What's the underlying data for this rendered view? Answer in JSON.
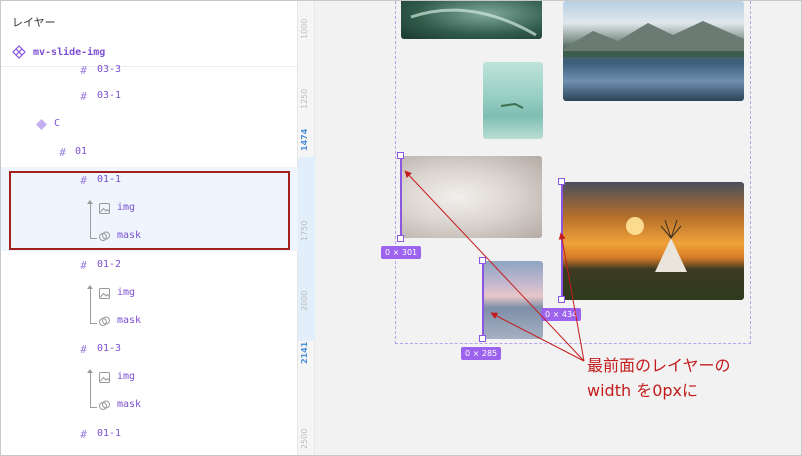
{
  "layers_panel": {
    "title": "レイヤー",
    "component_name": "mv-slide-img",
    "rows": [
      {
        "kind": "frame",
        "label": "03-3"
      },
      {
        "kind": "frame",
        "label": "03-1"
      },
      {
        "kind": "variant",
        "label": "C"
      },
      {
        "kind": "frame",
        "label": "01"
      },
      {
        "kind": "frame",
        "label": "01-1"
      },
      {
        "kind": "image",
        "label": "img"
      },
      {
        "kind": "mask",
        "label": "mask"
      },
      {
        "kind": "frame",
        "label": "01-2"
      },
      {
        "kind": "image",
        "label": "img"
      },
      {
        "kind": "mask",
        "label": "mask"
      },
      {
        "kind": "frame",
        "label": "01-3"
      },
      {
        "kind": "image",
        "label": "img"
      },
      {
        "kind": "mask",
        "label": "mask"
      },
      {
        "kind": "frame",
        "label": "01-1"
      }
    ]
  },
  "ruler": {
    "ticks": [
      "1000",
      "1250",
      "1474",
      "1750",
      "2000",
      "2141",
      "2500"
    ]
  },
  "canvas": {
    "badges": [
      "0 × 301",
      "0 × 434",
      "0 × 285"
    ]
  },
  "annotation": {
    "line1": "最前面のレイヤーの",
    "line2": "width を0pxに",
    "color": "#c41c1c"
  },
  "colors": {
    "accent_purple": "#8a56e2",
    "highlight_red": "#a11f1f",
    "selection_bg": "#eef5fd"
  }
}
